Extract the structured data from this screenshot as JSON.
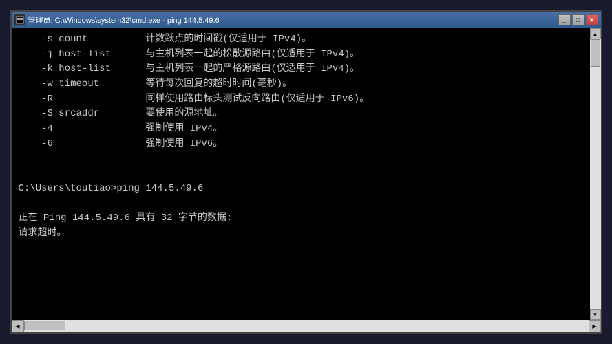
{
  "window": {
    "title": "管理员: C:\\Windows\\system32\\cmd.exe - ping  144.5.49.6",
    "title_icon": "cmd-icon"
  },
  "titlebar": {
    "minimize_label": "_",
    "maximize_label": "□",
    "close_label": "✕"
  },
  "console": {
    "lines": [
      "    -s count          计数跃点的时间戳(仅适用于 IPv4)。",
      "    -j host-list      与主机列表一起的松散源路由(仅适用于 IPv4)。",
      "    -k host-list      与主机列表一起的严格源路由(仅适用于 IPv4)。",
      "    -w timeout        等待每次回复的超时时间(毫秒)。",
      "    -R                同样使用路由标头测试反向路由(仅适用于 IPv6)。",
      "    -S srcaddr        要使用的源地址。",
      "    -4                强制使用 IPv4。",
      "    -6                强制使用 IPv6。",
      "",
      "",
      "C:\\Users\\toutiao>ping 144.5.49.6",
      "",
      "正在 Ping 144.5.49.6 具有 32 字节的数据:",
      "请求超时。"
    ]
  }
}
